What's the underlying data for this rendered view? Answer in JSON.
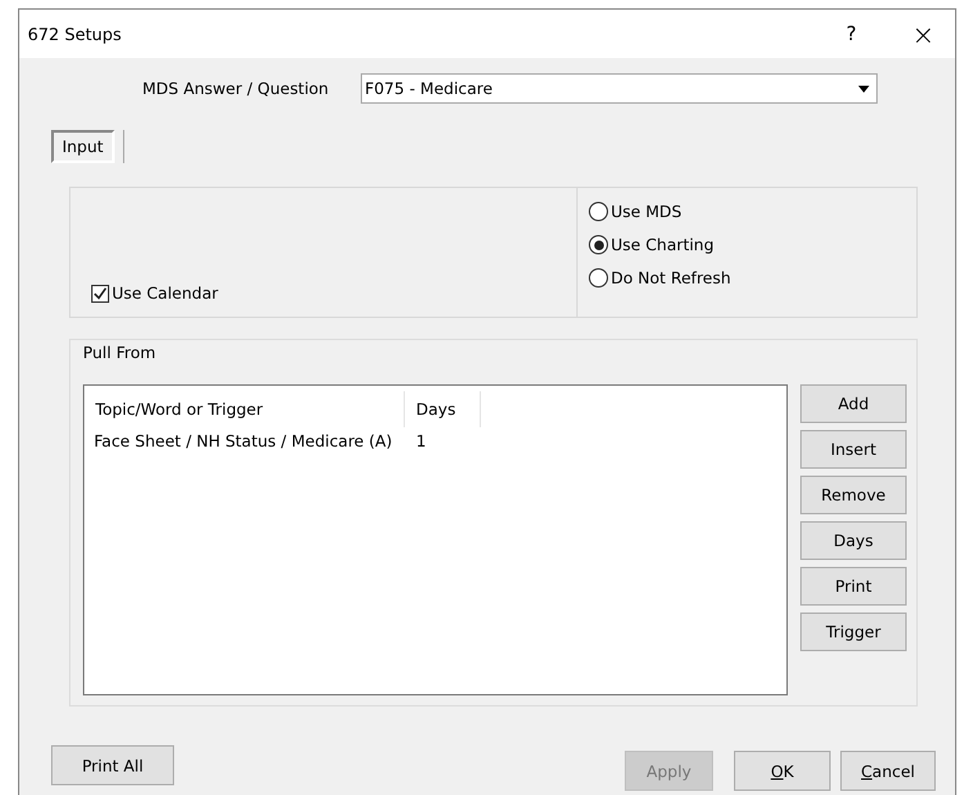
{
  "window": {
    "title": "672 Setups",
    "help": "?",
    "close": "×"
  },
  "mds": {
    "label": "MDS Answer / Question",
    "value": "F075 - Medicare"
  },
  "tabs": [
    {
      "label": "Input",
      "selected": true
    }
  ],
  "use_calendar": {
    "label": "Use Calendar",
    "checked": true
  },
  "source_options": [
    {
      "label": "Use MDS",
      "selected": false
    },
    {
      "label": "Use Charting",
      "selected": true
    },
    {
      "label": "Do Not Refresh",
      "selected": false
    }
  ],
  "pull_from": {
    "title": "Pull From",
    "columns": [
      "Topic/Word or Trigger",
      "Days"
    ],
    "rows": [
      {
        "topic": "Face Sheet / NH Status / Medicare (A)",
        "days": "1"
      }
    ],
    "buttons": [
      "Add",
      "Insert",
      "Remove",
      "Days",
      "Print",
      "Trigger"
    ]
  },
  "footer_buttons": [
    {
      "label": "Print All",
      "disabled": false,
      "mnemonic": false
    },
    {
      "label": "Apply",
      "disabled": true,
      "mnemonic": false
    },
    {
      "label": "OK",
      "disabled": false,
      "mnemonic": true
    },
    {
      "label": "Cancel",
      "disabled": false,
      "mnemonic": true
    }
  ]
}
